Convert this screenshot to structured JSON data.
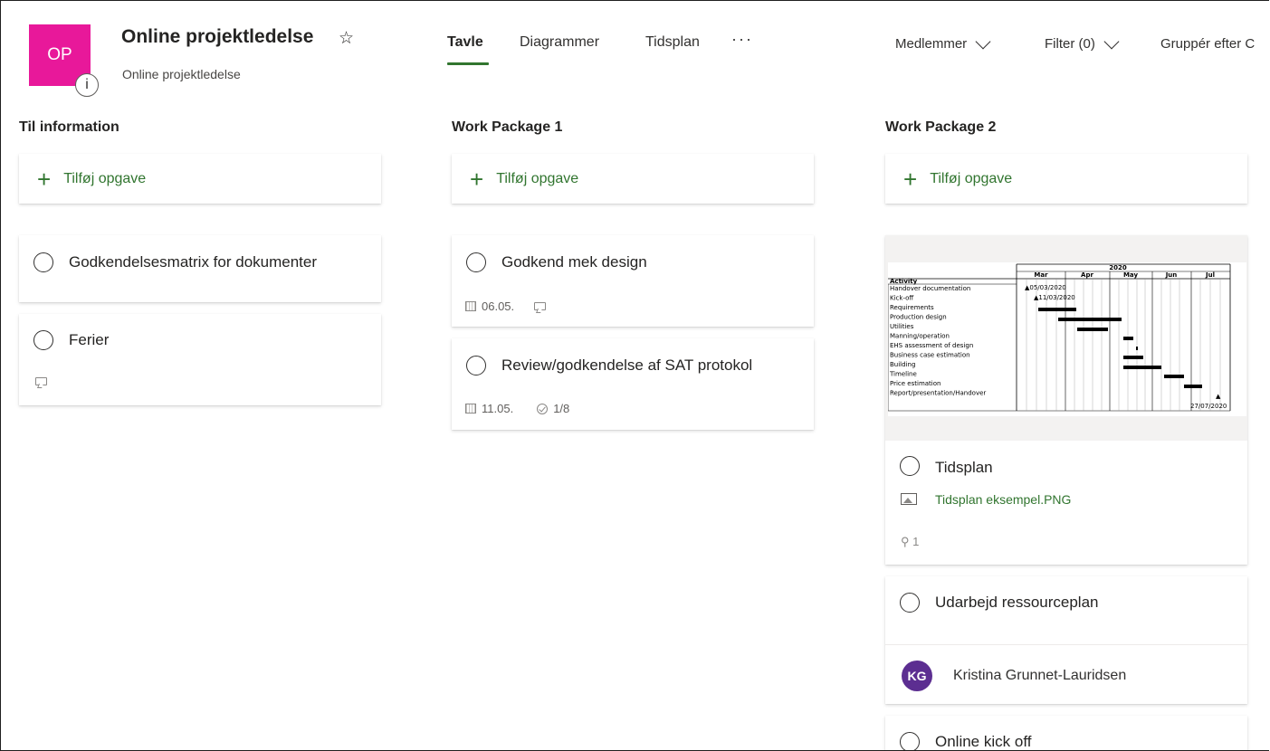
{
  "header": {
    "avatar_initials": "OP",
    "info_icon_text": "i",
    "title": "Online projektledelse",
    "subtitle": "Online projektledelse",
    "tabs": [
      {
        "label": "Tavle",
        "active": true
      },
      {
        "label": "Diagrammer",
        "active": false
      },
      {
        "label": "Tidsplan",
        "active": false
      }
    ],
    "more_label": "···",
    "members_label": "Medlemmer",
    "filter_label": "Filter (0)",
    "group_label": "Gruppér efter C"
  },
  "colors": {
    "accent": "#31752f",
    "avatar_plan": "#e8189a",
    "avatar_person": "#5c2e91"
  },
  "buckets": [
    {
      "title": "Til information",
      "add_label": "Tilføj opgave",
      "tasks": [
        {
          "title": "Godkendelsesmatrix for dokumenter"
        },
        {
          "title": "Ferier",
          "has_comment": true
        }
      ]
    },
    {
      "title": "Work Package 1",
      "add_label": "Tilføj opgave",
      "tasks": [
        {
          "title": "Godkend mek design",
          "due": "06.05.",
          "has_comment": true
        },
        {
          "title": "Review/godkendelse af SAT protokol",
          "due": "11.05.",
          "checklist": "1/8"
        }
      ]
    },
    {
      "title": "Work Package 2",
      "add_label": "Tilføj opgave",
      "tasks": [
        {
          "title": "Tidsplan",
          "attachment": "Tidsplan eksempel.PNG",
          "attachment_count": "1",
          "preview": {
            "year": "2020",
            "activity_header": "Activity",
            "months": [
              "Mar",
              "Apr",
              "May",
              "Jun",
              "Jul"
            ],
            "rows": [
              "Handover documentation",
              "Kick-off",
              "Requirements",
              "Production design",
              "Utilities",
              "Manning/operation",
              "EHS assessment of design",
              "Business case estimation",
              "Building",
              "Timeline",
              "Price estimation",
              "Report/presentation/Handover"
            ],
            "milestone_1": "05/03/2020",
            "milestone_2": "11/03/2020",
            "milestone_3": "27/07/2020"
          }
        },
        {
          "title": "Udarbejd ressourceplan",
          "assignee_initials": "KG",
          "assignee_name": "Kristina Grunnet-Lauridsen"
        },
        {
          "title": "Online kick off"
        }
      ]
    }
  ]
}
